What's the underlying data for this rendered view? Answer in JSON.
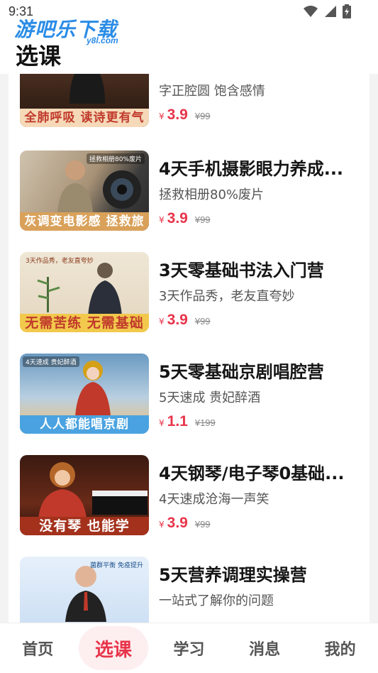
{
  "status_bar": {
    "time": "9:31",
    "icons": [
      "wifi-icon",
      "signal-icon",
      "battery-icon"
    ]
  },
  "watermark": {
    "text": "游吧乐下载",
    "sub": "y8l.com"
  },
  "header": {
    "title": "选课"
  },
  "colors": {
    "accent": "#e8344a",
    "price": "#e8344a",
    "tab_active_bg": "#fdeef0"
  },
  "courses": [
    {
      "title": "",
      "subtitle": "字正腔圆 饱含感情",
      "currency": "¥",
      "price": "3.9",
      "original_price": "¥99",
      "thumb_tag": "",
      "thumb_caption": "全肺呼吸 读诗更有气势"
    },
    {
      "title": "4天手机摄影眼力养成...",
      "subtitle": "拯救相册80%废片",
      "currency": "¥",
      "price": "3.9",
      "original_price": "¥99",
      "thumb_tag": "拯救相册80%废片",
      "thumb_caption": "灰调变电影感 拯救旅行遗憾"
    },
    {
      "title": "3天零基础书法入门营",
      "subtitle": "3天作品秀，老友直夸妙",
      "currency": "¥",
      "price": "3.9",
      "original_price": "¥99",
      "thumb_tag": "3天作品秀，老友直夸妙",
      "thumb_caption": "无需苦练 无需基础"
    },
    {
      "title": "5天零基础京剧唱腔营",
      "subtitle": "5天速成 贵妃醉酒",
      "currency": "¥",
      "price": "1.1",
      "original_price": "¥199",
      "thumb_tag": "4天速成 贵妃醉酒",
      "thumb_caption": "人人都能唱京剧"
    },
    {
      "title": "4天钢琴/电子琴0基础...",
      "subtitle": "4天速成沧海一声笑",
      "currency": "¥",
      "price": "3.9",
      "original_price": "¥99",
      "thumb_tag": "",
      "thumb_caption": "没有琴 也能学"
    },
    {
      "title": "5天营养调理实操营",
      "subtitle": "一站式了解你的问题",
      "currency": "¥",
      "price": "",
      "original_price": "",
      "thumb_tag": "菌群平衡 免疫提升",
      "thumb_caption": ""
    }
  ],
  "tabbar": {
    "items": [
      {
        "label": "首页"
      },
      {
        "label": "选课"
      },
      {
        "label": "学习"
      },
      {
        "label": "消息"
      },
      {
        "label": "我的"
      }
    ],
    "active": "选课"
  }
}
